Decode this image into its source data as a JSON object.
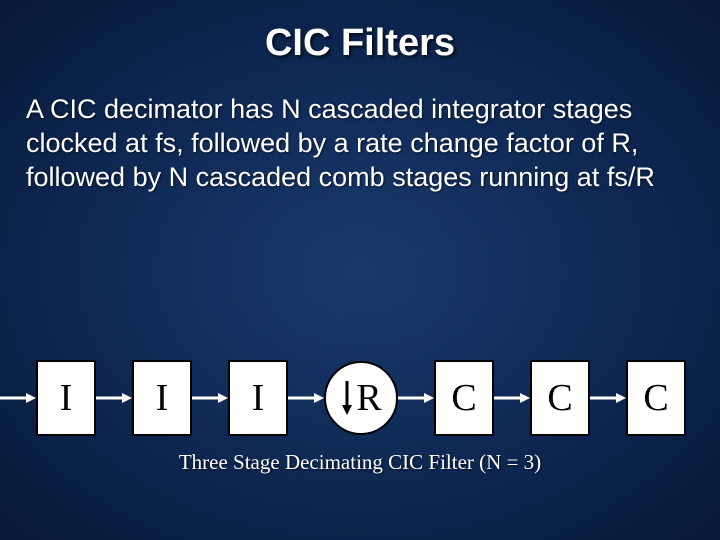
{
  "title": "CIC Filters",
  "description": "A CIC decimator has N cascaded integrator stages clocked at fs, followed by a rate change factor of R, followed by N cascaded comb stages running at fs/R",
  "stages": {
    "integrator": "I",
    "rate_change": "R",
    "comb": "C"
  },
  "caption": "Three Stage Decimating CIC Filter  (N = 3)",
  "colors": {
    "background_center": "#1a3a6e",
    "background_edge": "#081838",
    "box_fill": "#ffffff",
    "box_border": "#000000"
  }
}
